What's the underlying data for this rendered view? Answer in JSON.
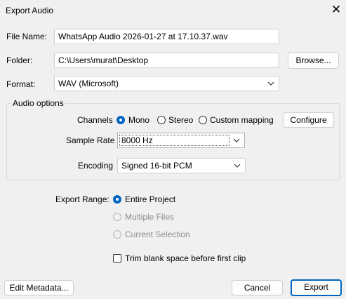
{
  "window": {
    "title": "Export Audio",
    "close_glyph": "✕"
  },
  "file_name": {
    "label": "File Name:",
    "value": "WhatsApp Audio 2026-01-27 at 17.10.37.wav"
  },
  "folder": {
    "label": "Folder:",
    "value": "C:\\Users\\murat\\Desktop",
    "browse_label": "Browse..."
  },
  "format": {
    "label": "Format:",
    "selected": "WAV (Microsoft)"
  },
  "audio_options": {
    "title": "Audio options",
    "channels": {
      "label": "Channels",
      "options": [
        {
          "label": "Mono",
          "selected": true
        },
        {
          "label": "Stereo",
          "selected": false
        },
        {
          "label": "Custom mapping",
          "selected": false
        }
      ],
      "configure_label": "Configure"
    },
    "sample_rate": {
      "label": "Sample Rate",
      "selected": "8000 Hz"
    },
    "encoding": {
      "label": "Encoding",
      "selected": "Signed 16-bit PCM"
    }
  },
  "export_range": {
    "label": "Export Range:",
    "options": [
      {
        "label": "Entire Project",
        "selected": true,
        "enabled": true
      },
      {
        "label": "Multiple Files",
        "selected": false,
        "enabled": false
      },
      {
        "label": "Current Selection",
        "selected": false,
        "enabled": false
      }
    ],
    "trim_label": "Trim blank space before first clip",
    "trim_checked": false
  },
  "footer": {
    "edit_metadata_label": "Edit Metadata...",
    "cancel_label": "Cancel",
    "export_label": "Export"
  },
  "colors": {
    "accent": "#0067c0",
    "background": "#f0f0f0"
  }
}
